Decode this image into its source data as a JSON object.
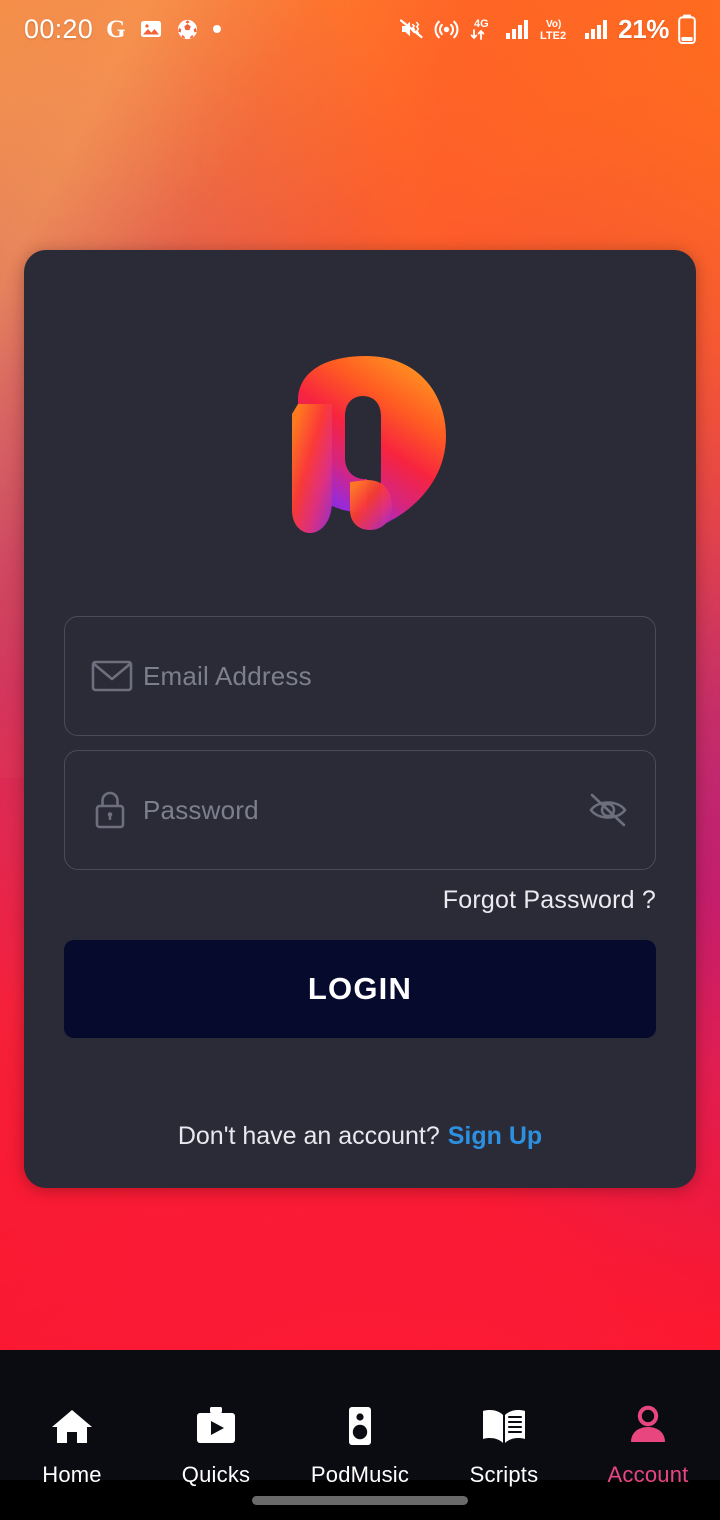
{
  "status_bar": {
    "time": "00:20",
    "left_icons": [
      {
        "name": "google-icon",
        "glyph": "G"
      },
      {
        "name": "gallery-image-icon"
      },
      {
        "name": "football-icon"
      },
      {
        "name": "notification-dot-icon"
      }
    ],
    "right_icons": [
      {
        "name": "volume-mute-vibrate-icon"
      },
      {
        "name": "hotspot-icon"
      },
      {
        "name": "4g-data-transfer-icon",
        "label": "4G"
      },
      {
        "name": "signal-bars-sim1-icon"
      },
      {
        "name": "volte2-icon",
        "label": "VoLTE2"
      },
      {
        "name": "signal-bars-sim2-icon"
      }
    ],
    "battery_percent": "21%"
  },
  "login_card": {
    "logo": {
      "name": "app-logo",
      "gradient_start": "#ff5a1f",
      "gradient_mid": "#f4245c",
      "gradient_end": "#8b2bd6"
    },
    "email": {
      "icon": "envelope-icon",
      "placeholder": "Email Address",
      "value": ""
    },
    "password": {
      "icon": "lock-icon",
      "placeholder": "Password",
      "value": "",
      "toggle_icon": "eye-off-icon",
      "visible": false
    },
    "forgot_password_label": "Forgot Password ?",
    "login_button_label": "LOGIN",
    "login_button_color": "#060a2c",
    "signup_prompt": "Don't have an account?",
    "signup_link_label": "Sign Up",
    "signup_link_color": "#2d8fe0",
    "card_color": "#2a2b37",
    "placeholder_color": "#7e7f8d"
  },
  "bottom_nav": {
    "active_color": "#e8467f",
    "inactive_color": "#ffffff",
    "items": [
      {
        "label": "Home",
        "icon": "home-icon",
        "active": false
      },
      {
        "label": "Quicks",
        "icon": "briefcase-play-icon",
        "active": false
      },
      {
        "label": "PodMusic",
        "icon": "speaker-icon",
        "active": false
      },
      {
        "label": "Scripts",
        "icon": "open-book-icon",
        "active": false
      },
      {
        "label": "Account",
        "icon": "person-icon",
        "active": true
      }
    ]
  },
  "system_bar": {
    "gesture_handle": "gesture-bar"
  }
}
